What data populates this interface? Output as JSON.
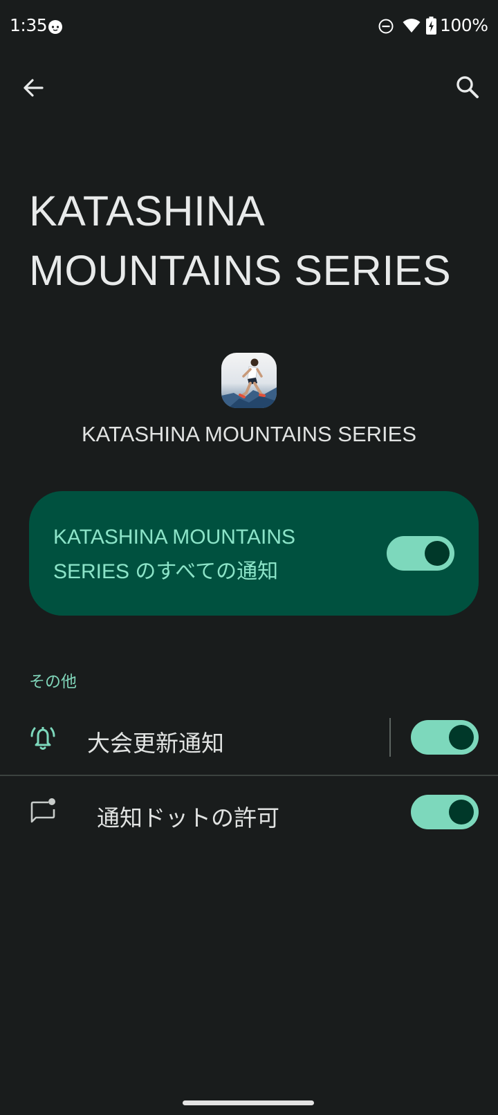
{
  "status_bar": {
    "time": "1:35",
    "battery": "100%"
  },
  "toolbar": {
    "back_icon": "arrow-back-icon",
    "search_icon": "search-icon"
  },
  "page_title": "KATASHINA MOUNTAINS SERIES",
  "app": {
    "name": "KATASHINA MOUNTAINS SERIES"
  },
  "main_switch": {
    "label": "KATASHINA MOUNTAINS SERIES のすべての通知",
    "on": true
  },
  "section": {
    "header": "その他"
  },
  "rows": [
    {
      "label": "大会更新通知",
      "icon": "bell-icon",
      "on": true
    },
    {
      "label": "通知ドットの許可",
      "icon": "notification-dot-icon",
      "on": true
    }
  ],
  "colors": {
    "background": "#191c1c",
    "card": "#00513f",
    "accent": "#7dd8bc",
    "accent_text": "#8ce4c8",
    "thumb": "#003829"
  }
}
